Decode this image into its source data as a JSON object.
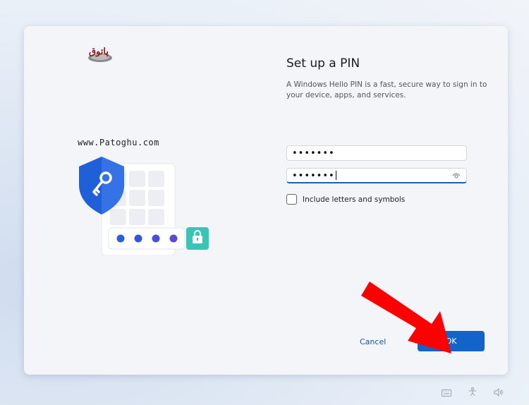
{
  "watermark": "www.Patoghu.com",
  "logo": {
    "text": "پاتوق"
  },
  "setup": {
    "title": "Set up a PIN",
    "description": "A Windows Hello PIN is a fast, secure way to sign in to your device, apps, and services.",
    "new_pin_value": "•••••••",
    "confirm_pin_value": "•••••••",
    "checkbox_label": "Include letters and symbols",
    "checkbox_checked": false
  },
  "buttons": {
    "cancel": "Cancel",
    "ok": "OK"
  },
  "colors": {
    "accent": "#1364c9",
    "shield": "#1f5fd8",
    "annotation_arrow": "#ff0000",
    "lock_badge": "#39c5b6"
  },
  "icons": [
    "shield-key-icon",
    "lock-icon",
    "eye-icon",
    "keyboard-icon",
    "accessibility-icon",
    "volume-icon"
  ]
}
